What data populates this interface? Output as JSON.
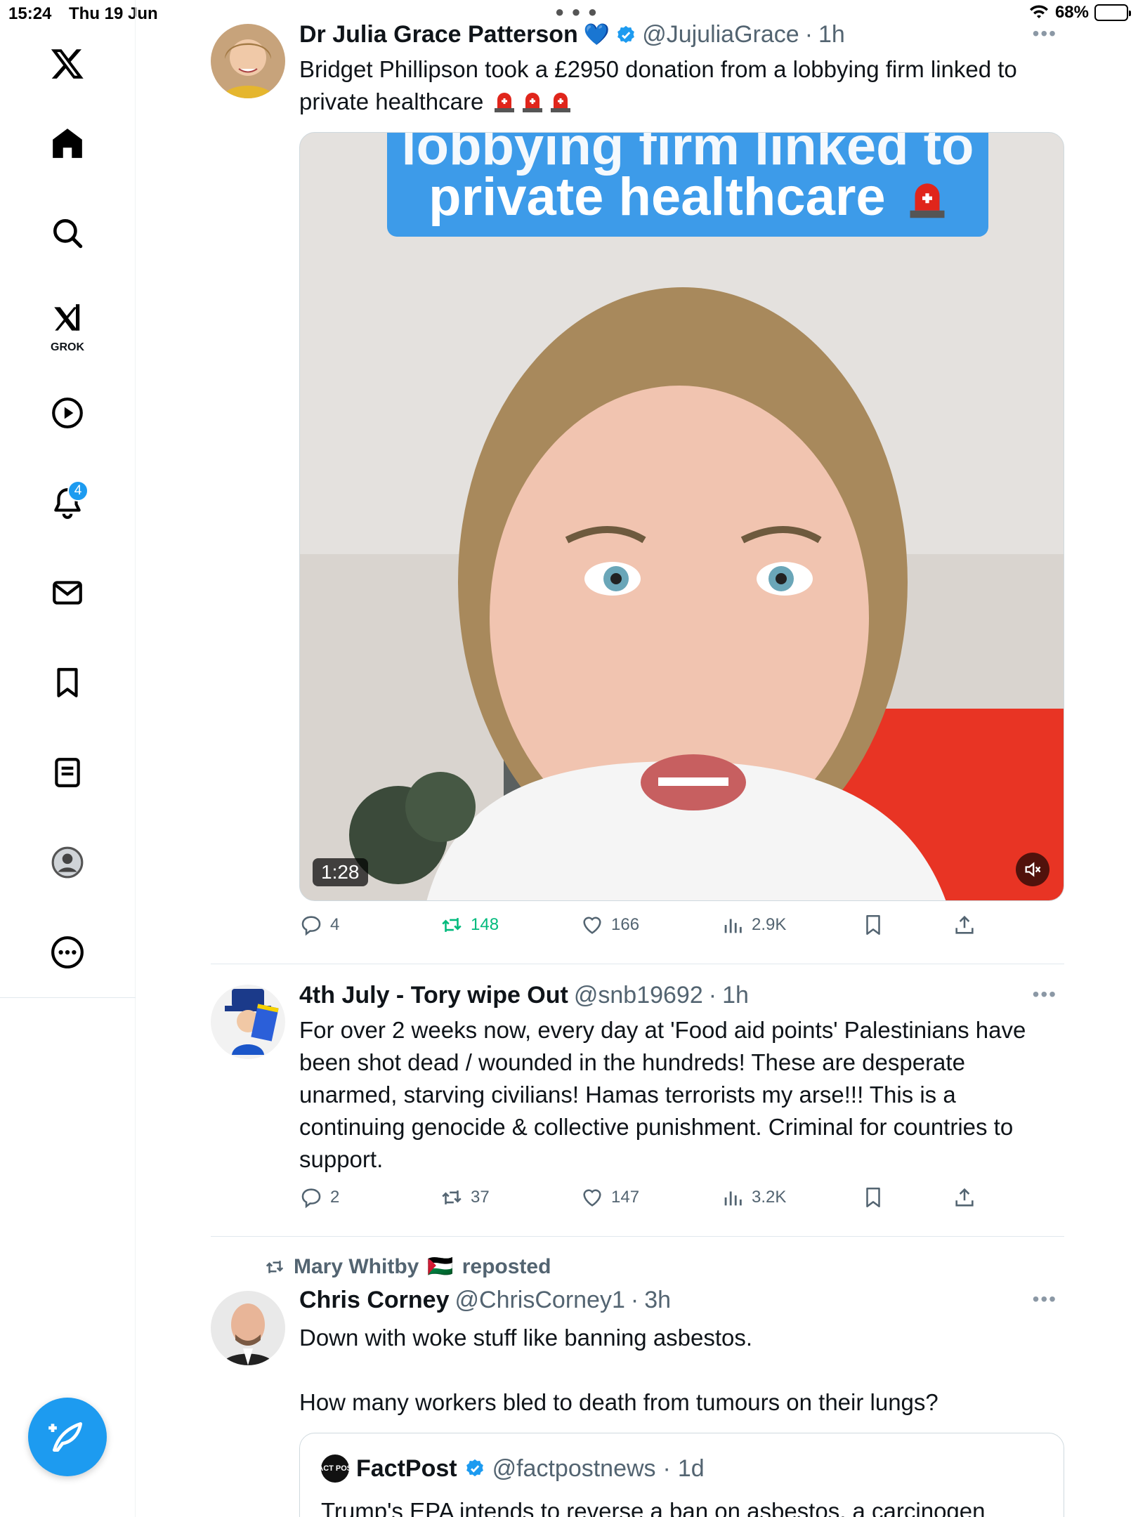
{
  "status_bar": {
    "time": "15:24",
    "date": "Thu 19 Jun",
    "battery": "68%",
    "battery_level": 0.68
  },
  "sidebar": {
    "items": [
      {
        "name": "x-logo-icon"
      },
      {
        "name": "home-icon"
      },
      {
        "name": "search-icon"
      },
      {
        "name": "grok-icon",
        "label": "GROK"
      },
      {
        "name": "video-play-icon"
      },
      {
        "name": "notifications-bell-icon",
        "badge": "4"
      },
      {
        "name": "messages-mail-icon"
      },
      {
        "name": "bookmarks-icon"
      },
      {
        "name": "lists-icon"
      },
      {
        "name": "profile-icon"
      },
      {
        "name": "more-icon"
      }
    ],
    "compose_icon": "compose-feather-icon"
  },
  "tweets": [
    {
      "name": "Dr Julia Grace Patterson",
      "name_emoji": "💙",
      "handle": "@JujuliaGrace",
      "time": "1h",
      "text": "Bridget Phillipson took a £2950 donation from a lobbying firm linked to",
      "text_line2": "private healthcare",
      "video": {
        "caption_line1": "lobbying firm linked to",
        "caption_line2": "private healthcare",
        "duration": "1:28"
      },
      "stats": {
        "replies": "4",
        "reposts": "148",
        "likes": "166",
        "views": "2.9K"
      }
    },
    {
      "name": "4th July - Tory wipe Out",
      "handle": "@snb19692",
      "time": "1h",
      "text": "For over 2 weeks now, every day at 'Food aid points' Palestinians have been shot dead / wounded in the hundreds! These are desperate unarmed, starving civilians! Hamas terrorists my arse!!! This is a continuing genocide & collective punishment. Criminal for countries to support.",
      "stats": {
        "replies": "2",
        "reposts": "37",
        "likes": "147",
        "views": "3.2K"
      }
    },
    {
      "reposted_by": "Mary Whitby",
      "reposted_flag": "🇵🇸",
      "reposted_label": "reposted",
      "name": "Chris Corney",
      "handle": "@ChrisCorney1",
      "time": "3h",
      "text_p1": "Down with woke stuff like banning asbestos.",
      "text_p2": "How many workers bled to death from tumours on their lungs?",
      "quote": {
        "avatar_text": "FACT POST",
        "name": "FactPost",
        "handle": "@factpostnews",
        "time": "1d",
        "text": "Trump's EPA intends to reverse a ban on asbestos, a carcinogen"
      }
    }
  ],
  "colors": {
    "accent": "#1d9bf0",
    "repost_green": "#00ba7c",
    "muted": "#536471"
  }
}
